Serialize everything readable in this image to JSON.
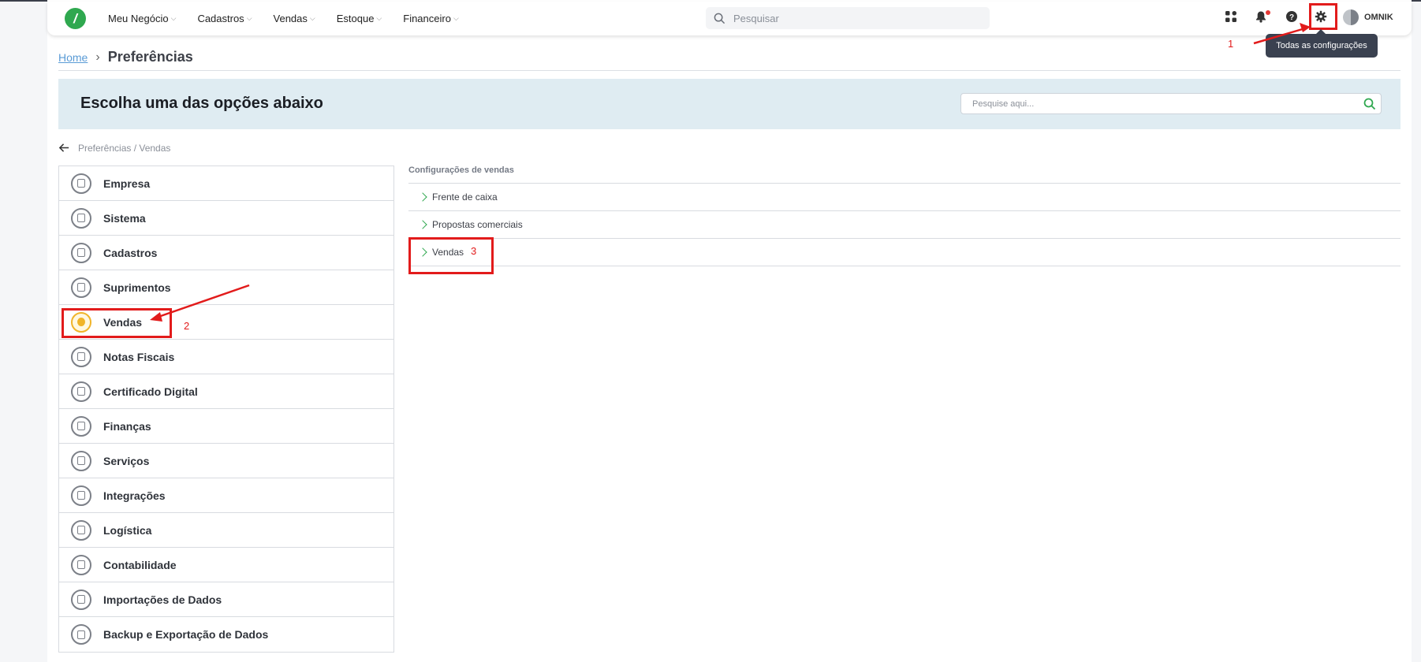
{
  "nav": {
    "items": [
      {
        "label": "Meu Negócio"
      },
      {
        "label": "Cadastros"
      },
      {
        "label": "Vendas"
      },
      {
        "label": "Estoque"
      },
      {
        "label": "Financeiro"
      }
    ],
    "search_placeholder": "Pesquisar",
    "username": "OMNIK",
    "brand_color": "#2fa84f"
  },
  "tooltip": "Todas as configurações",
  "breadcrumb": {
    "home": "Home",
    "current": "Preferências"
  },
  "banner": {
    "title": "Escolha uma das opções abaixo",
    "search_placeholder": "Pesquise aqui..."
  },
  "back_path": "Preferências / Vendas",
  "sidebar": {
    "items": [
      {
        "label": "Empresa",
        "icon": "chart-icon"
      },
      {
        "label": "Sistema",
        "icon": "monitor-icon"
      },
      {
        "label": "Cadastros",
        "icon": "book-icon"
      },
      {
        "label": "Suprimentos",
        "icon": "box-icon"
      },
      {
        "label": "Vendas",
        "icon": "sales-icon",
        "active": true
      },
      {
        "label": "Notas Fiscais",
        "icon": "invoice-icon"
      },
      {
        "label": "Certificado Digital",
        "icon": "lock-icon"
      },
      {
        "label": "Finanças",
        "icon": "piggy-bank-icon"
      },
      {
        "label": "Serviços",
        "icon": "document-icon"
      },
      {
        "label": "Integrações",
        "icon": "integration-icon"
      },
      {
        "label": "Logística",
        "icon": "truck-icon"
      },
      {
        "label": "Contabilidade",
        "icon": "calculator-icon"
      },
      {
        "label": "Importações de Dados",
        "icon": "import-icon"
      },
      {
        "label": "Backup e Exportação de Dados",
        "icon": "export-icon"
      }
    ]
  },
  "content": {
    "section_title": "Configurações de vendas",
    "items": [
      {
        "label": "Frente de caixa"
      },
      {
        "label": "Propostas comerciais"
      },
      {
        "label": "Vendas"
      }
    ]
  },
  "annotations": {
    "n1": "1",
    "n2": "2",
    "n3": "3",
    "color": "#e21b1b"
  }
}
